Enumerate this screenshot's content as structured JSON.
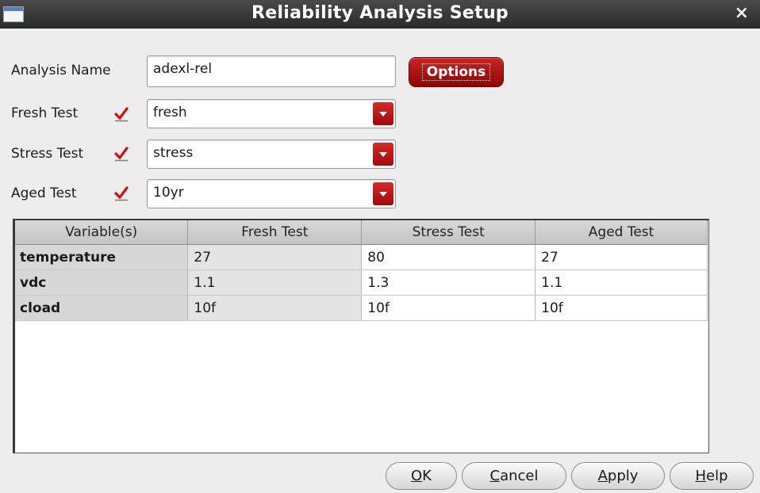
{
  "window": {
    "title": "Reliability Analysis Setup",
    "close_glyph": "×",
    "icon": "window-icon"
  },
  "form": {
    "analysis_name_label": "Analysis Name",
    "analysis_name_value": "adexl-rel",
    "options_label": "Options",
    "fresh_test": {
      "label": "Fresh Test",
      "checked": true,
      "value": "fresh"
    },
    "stress_test": {
      "label": "Stress Test",
      "checked": true,
      "value": "stress"
    },
    "aged_test": {
      "label": "Aged Test",
      "checked": true,
      "value": "10yr"
    }
  },
  "table": {
    "headers": [
      "Variable(s)",
      "Fresh Test",
      "Stress Test",
      "Aged Test"
    ],
    "rows": [
      {
        "variable": "temperature",
        "fresh": "27",
        "stress": "80",
        "aged": "27"
      },
      {
        "variable": "vdc",
        "fresh": "1.1",
        "stress": "1.3",
        "aged": "1.1"
      },
      {
        "variable": "cload",
        "fresh": "10f",
        "stress": "10f",
        "aged": "10f"
      }
    ]
  },
  "buttons": {
    "ok": {
      "mnemonic": "O",
      "rest": "K"
    },
    "cancel": {
      "mnemonic": "C",
      "rest": "ancel"
    },
    "apply": {
      "mnemonic": "A",
      "rest": "pply"
    },
    "help": {
      "mnemonic": "H",
      "rest": "elp"
    }
  },
  "colors": {
    "accent_red": "#b31515",
    "checkmark_red": "#d01010",
    "titlebar": "#2f2f2f"
  }
}
